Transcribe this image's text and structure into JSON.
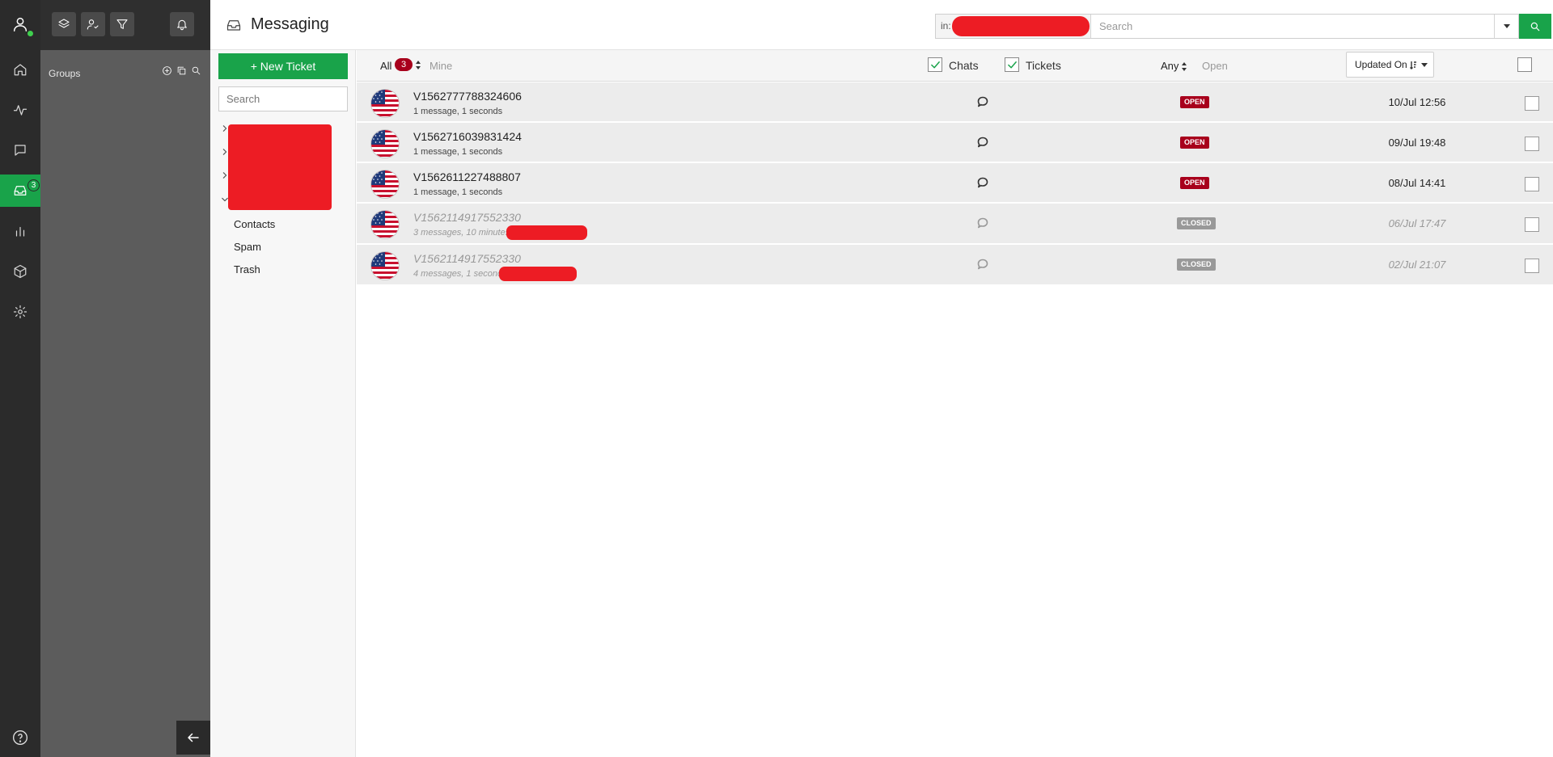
{
  "rail": {
    "items": [
      {
        "name": "home",
        "icon": "home-icon"
      },
      {
        "name": "activity",
        "icon": "activity-icon"
      },
      {
        "name": "chats",
        "icon": "chat-icon"
      },
      {
        "name": "inbox",
        "icon": "inbox-icon",
        "badge": "3",
        "active": true
      },
      {
        "name": "reports",
        "icon": "bar-chart-icon"
      },
      {
        "name": "packages",
        "icon": "box-icon"
      },
      {
        "name": "settings",
        "icon": "gear-icon"
      }
    ],
    "accent": "#19a34a"
  },
  "groups": {
    "title": "Groups"
  },
  "header": {
    "title": "Messaging",
    "search_scope": "in:",
    "search_placeholder": "Search"
  },
  "folders": {
    "new_ticket_label": "+ New Ticket",
    "search_placeholder": "Search",
    "items": [
      "Contacts",
      "Spam",
      "Trash"
    ]
  },
  "toolbar": {
    "all_label": "All",
    "all_count": "3",
    "mine_label": "Mine",
    "chats_label": "Chats",
    "tickets_label": "Tickets",
    "any_label": "Any",
    "open_label": "Open",
    "sort_label": "Updated On"
  },
  "tickets": [
    {
      "id": "V1562777788324606",
      "meta": "1 message, 1 seconds",
      "status": "OPEN",
      "date": "10/Jul 12:56"
    },
    {
      "id": "V1562716039831424",
      "meta": "1 message, 1 seconds",
      "status": "OPEN",
      "date": "09/Jul 19:48"
    },
    {
      "id": "V1562611227488807",
      "meta": "1 message, 1 seconds",
      "status": "OPEN",
      "date": "08/Jul 14:41"
    },
    {
      "id": "V1562114917552330",
      "meta": "3 messages, 10 minutes",
      "status": "CLOSED",
      "date": "06/Jul 17:47"
    },
    {
      "id": "V1562114917552330",
      "meta": "4 messages, 1 seconds",
      "status": "CLOSED",
      "date": "02/Jul 21:07"
    }
  ],
  "colors": {
    "brand_green": "#19a34a",
    "open_badge": "#a8001c",
    "closed_badge": "#999999",
    "redaction": "#ed1c24"
  }
}
